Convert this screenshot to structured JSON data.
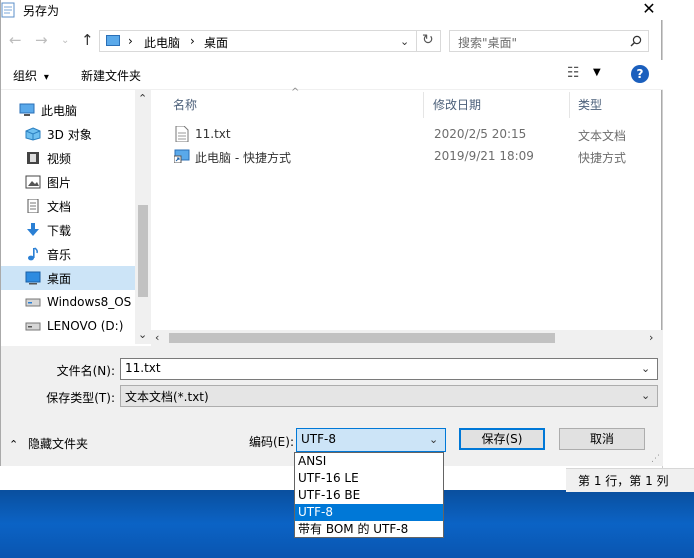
{
  "window": {
    "title": "另存为",
    "close_glyph": "✕"
  },
  "nav": {
    "path": [
      "此电脑",
      "桌面"
    ],
    "search_placeholder": "搜索\"桌面\""
  },
  "toolbar": {
    "organize": "组织",
    "new_folder": "新建文件夹",
    "view_glyph": "☷",
    "help_glyph": "?"
  },
  "sidebar": [
    {
      "label": "此电脑",
      "icon": "computer-icon"
    },
    {
      "label": "3D 对象",
      "icon": "cube-icon"
    },
    {
      "label": "视频",
      "icon": "video-icon"
    },
    {
      "label": "图片",
      "icon": "picture-icon"
    },
    {
      "label": "文档",
      "icon": "document-icon"
    },
    {
      "label": "下载",
      "icon": "download-icon"
    },
    {
      "label": "音乐",
      "icon": "music-icon"
    },
    {
      "label": "桌面",
      "icon": "desktop-icon",
      "selected": true
    },
    {
      "label": "Windows8_OS",
      "icon": "drive-icon"
    },
    {
      "label": "LENOVO (D:)",
      "icon": "drive-icon"
    }
  ],
  "columns": {
    "name": "名称",
    "modified": "修改日期",
    "type": "类型"
  },
  "files": [
    {
      "name": "11.txt",
      "modified": "2020/2/5 20:15",
      "type": "文本文档",
      "icon": "text-file-icon"
    },
    {
      "name": "此电脑 - 快捷方式",
      "modified": "2019/9/21 18:09",
      "type": "快捷方式",
      "icon": "shortcut-icon"
    }
  ],
  "form": {
    "filename_label": "文件名(N):",
    "filename_value": "11.txt",
    "filetype_label": "保存类型(T):",
    "filetype_value": "文本文档(*.txt)",
    "hide_folders": "隐藏文件夹",
    "encoding_label": "编码(E):",
    "encoding_value": "UTF-8",
    "save_button": "保存(S)",
    "cancel_button": "取消"
  },
  "encoding_options": [
    "ANSI",
    "UTF-16 LE",
    "UTF-16 BE",
    "UTF-8",
    "带有 BOM 的 UTF-8"
  ],
  "notepad_status": "第 1 行，第 1 列",
  "colors": {
    "accent": "#0078d7",
    "selection": "#cce4f7",
    "help": "#1b5fbd"
  }
}
